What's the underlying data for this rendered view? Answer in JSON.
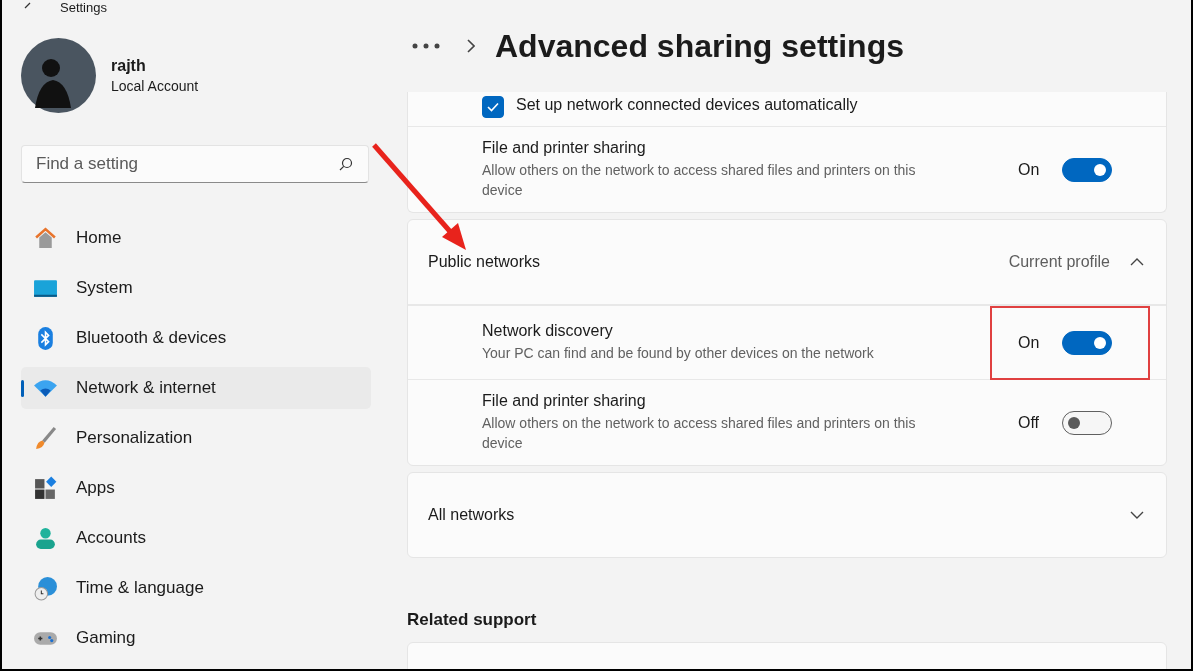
{
  "titlebar": {
    "title": "Settings"
  },
  "account": {
    "name": "rajth",
    "type": "Local Account"
  },
  "search": {
    "placeholder": "Find a setting"
  },
  "nav": [
    {
      "kind": "home",
      "label": "Home",
      "selected": false
    },
    {
      "kind": "system",
      "label": "System",
      "selected": false
    },
    {
      "kind": "bluetooth",
      "label": "Bluetooth & devices",
      "selected": false
    },
    {
      "kind": "network",
      "label": "Network & internet",
      "selected": true
    },
    {
      "kind": "personalization",
      "label": "Personalization",
      "selected": false
    },
    {
      "kind": "apps",
      "label": "Apps",
      "selected": false
    },
    {
      "kind": "accounts",
      "label": "Accounts",
      "selected": false
    },
    {
      "kind": "time",
      "label": "Time & language",
      "selected": false
    },
    {
      "kind": "gaming",
      "label": "Gaming",
      "selected": false
    }
  ],
  "page_title": "Advanced sharing settings",
  "sections": [
    {
      "kind": "group",
      "rows": [
        {
          "kind": "checkbox",
          "label": "Set up network connected devices automatically",
          "checked": true
        },
        {
          "kind": "toggle",
          "title": "File and printer sharing",
          "description": "Allow others on the network to access shared files and printers on this device",
          "state": "On",
          "on": true,
          "highlighted": false
        }
      ]
    },
    {
      "kind": "expander",
      "title": "Public networks",
      "status": "Current profile",
      "expanded": true,
      "rows": [
        {
          "kind": "toggle",
          "title": "Network discovery",
          "description": "Your PC can find and be found by other devices on the network",
          "state": "On",
          "on": true,
          "highlighted": true
        },
        {
          "kind": "toggle",
          "title": "File and printer sharing",
          "description": "Allow others on the network to access shared files and printers on this device",
          "state": "Off",
          "on": false,
          "highlighted": false
        }
      ]
    },
    {
      "kind": "expander",
      "title": "All networks",
      "expanded": false
    }
  ],
  "related": {
    "title": "Related support"
  }
}
